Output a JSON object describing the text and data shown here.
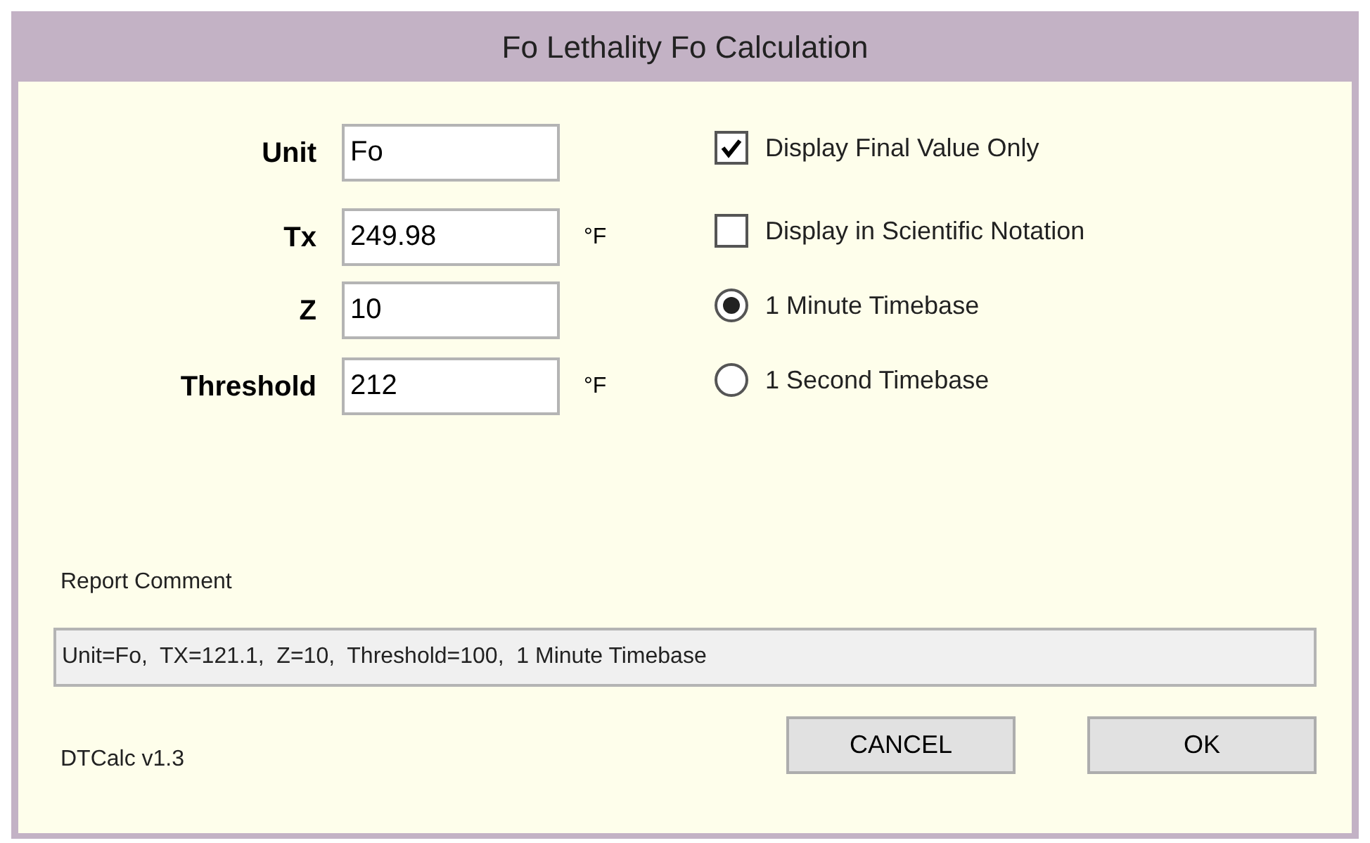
{
  "window": {
    "title": "Fo Lethality Fo Calculation"
  },
  "fields": [
    {
      "label": "Unit",
      "value": "Fo"
    },
    {
      "label": "Tx",
      "value": "249.98",
      "unit": "°F"
    },
    {
      "label": "Z",
      "value": "10"
    },
    {
      "label": "Threshold",
      "value": "212",
      "unit": "°F"
    }
  ],
  "options": [
    {
      "kind": "checkbox",
      "label": "Display Final Value Only",
      "checked": true
    },
    {
      "kind": "checkbox",
      "label": "Display in Scientific Notation",
      "checked": false
    },
    {
      "kind": "radio",
      "label": "1 Minute Timebase",
      "selected": true
    },
    {
      "kind": "radio",
      "label": "1 Second Timebase",
      "selected": false
    }
  ],
  "report_comment": {
    "label": "Report Comment",
    "value": "Unit=Fo,  TX=121.1,  Z=10,  Threshold=100,  1 Minute Timebase"
  },
  "version": "DTCalc v1.3",
  "buttons": [
    "CANCEL",
    "OK"
  ]
}
